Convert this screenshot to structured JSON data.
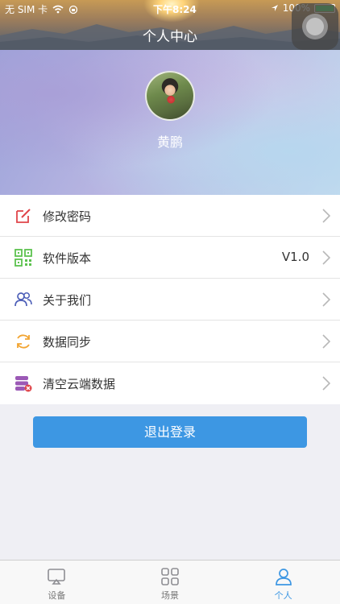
{
  "status_bar": {
    "carrier": "无 SIM 卡",
    "time": "下午8:24",
    "battery": "100%"
  },
  "header": {
    "title": "个人中心"
  },
  "profile": {
    "username": "黄鹏"
  },
  "menu": {
    "items": [
      {
        "label": "修改密码",
        "value": "",
        "icon": "edit-icon",
        "color": "#e0454a"
      },
      {
        "label": "软件版本",
        "value": "V1.0",
        "icon": "qr-code-icon",
        "color": "#5cc24e"
      },
      {
        "label": "关于我们",
        "value": "",
        "icon": "users-icon",
        "color": "#4d5fb8"
      },
      {
        "label": "数据同步",
        "value": "",
        "icon": "sync-icon",
        "color": "#f2a533"
      },
      {
        "label": "清空云端数据",
        "value": "",
        "icon": "database-clear-icon",
        "color": "#9b59b6"
      }
    ]
  },
  "logout": {
    "label": "退出登录",
    "color": "#3d97e3"
  },
  "tabs": [
    {
      "label": "设备",
      "icon": "device-icon",
      "active": false
    },
    {
      "label": "场景",
      "icon": "grid-icon",
      "active": false
    },
    {
      "label": "个人",
      "icon": "person-icon",
      "active": true
    }
  ]
}
